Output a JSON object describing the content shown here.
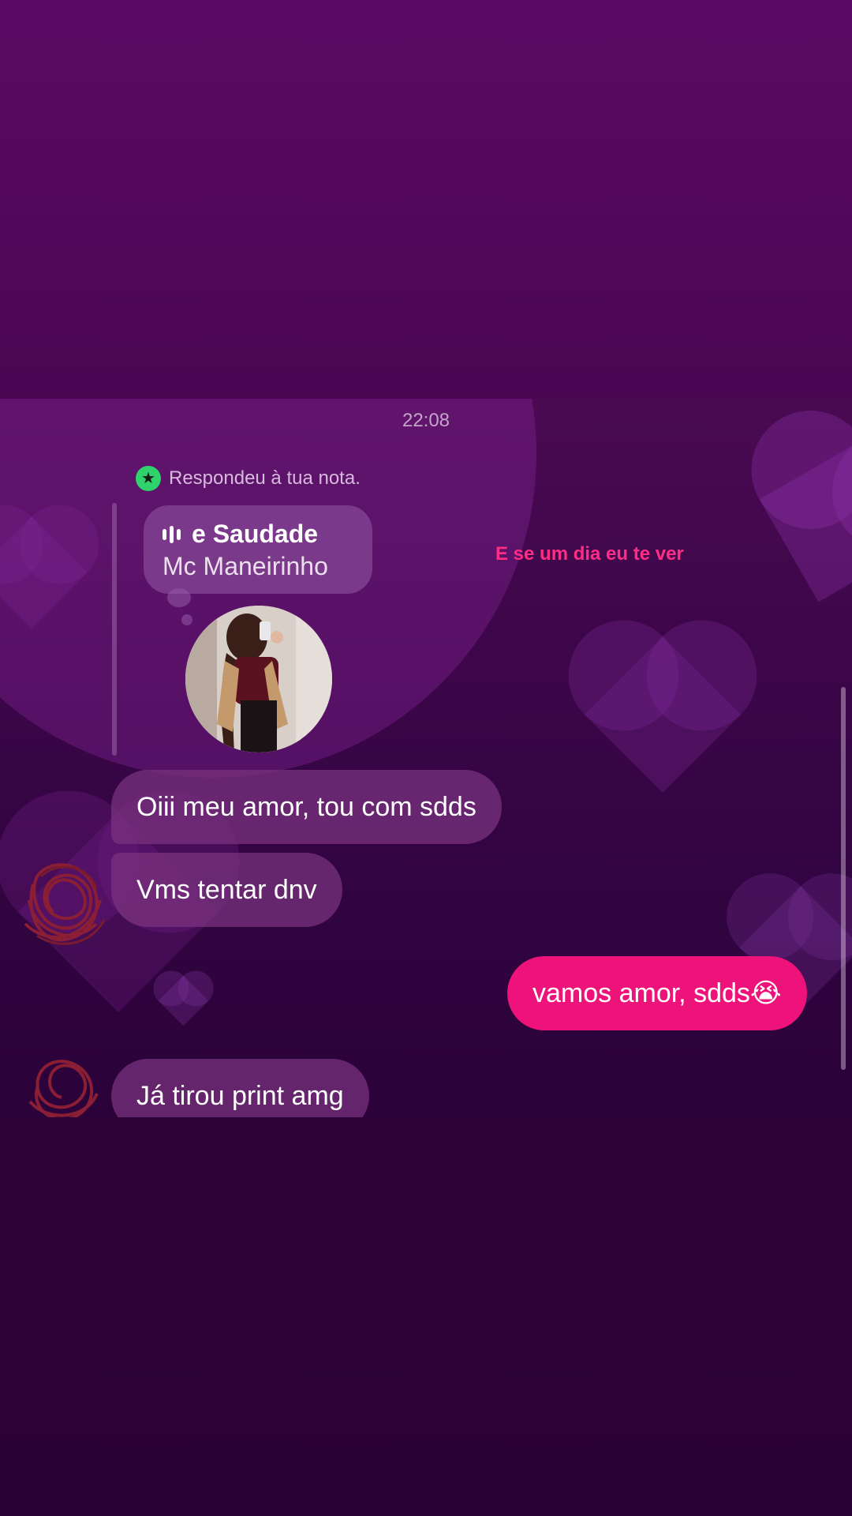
{
  "conversation": {
    "timestamp": "22:08",
    "reply_note_text": "Respondeu à tua nota.",
    "reply_note_icon": "star-icon",
    "note": {
      "song_title": "e Saudade",
      "song_artist": "Mc Maneirinho",
      "icon": "audio-wave-icon"
    },
    "lyric_overlay": "E se um dia eu te ver",
    "messages": [
      {
        "sender": "them",
        "text": "Oiii meu amor, tou com sdds"
      },
      {
        "sender": "them",
        "text": "Vms tentar dnv"
      },
      {
        "sender": "me",
        "text": "vamos amor, sdds😭"
      },
      {
        "sender": "them",
        "text": "Já tirou print amg"
      }
    ]
  },
  "colors": {
    "outgoing_bubble": "#ee137a",
    "incoming_bubble": "#78327d",
    "star_badge": "#2fd36b",
    "lyric": "#ff2d86"
  }
}
